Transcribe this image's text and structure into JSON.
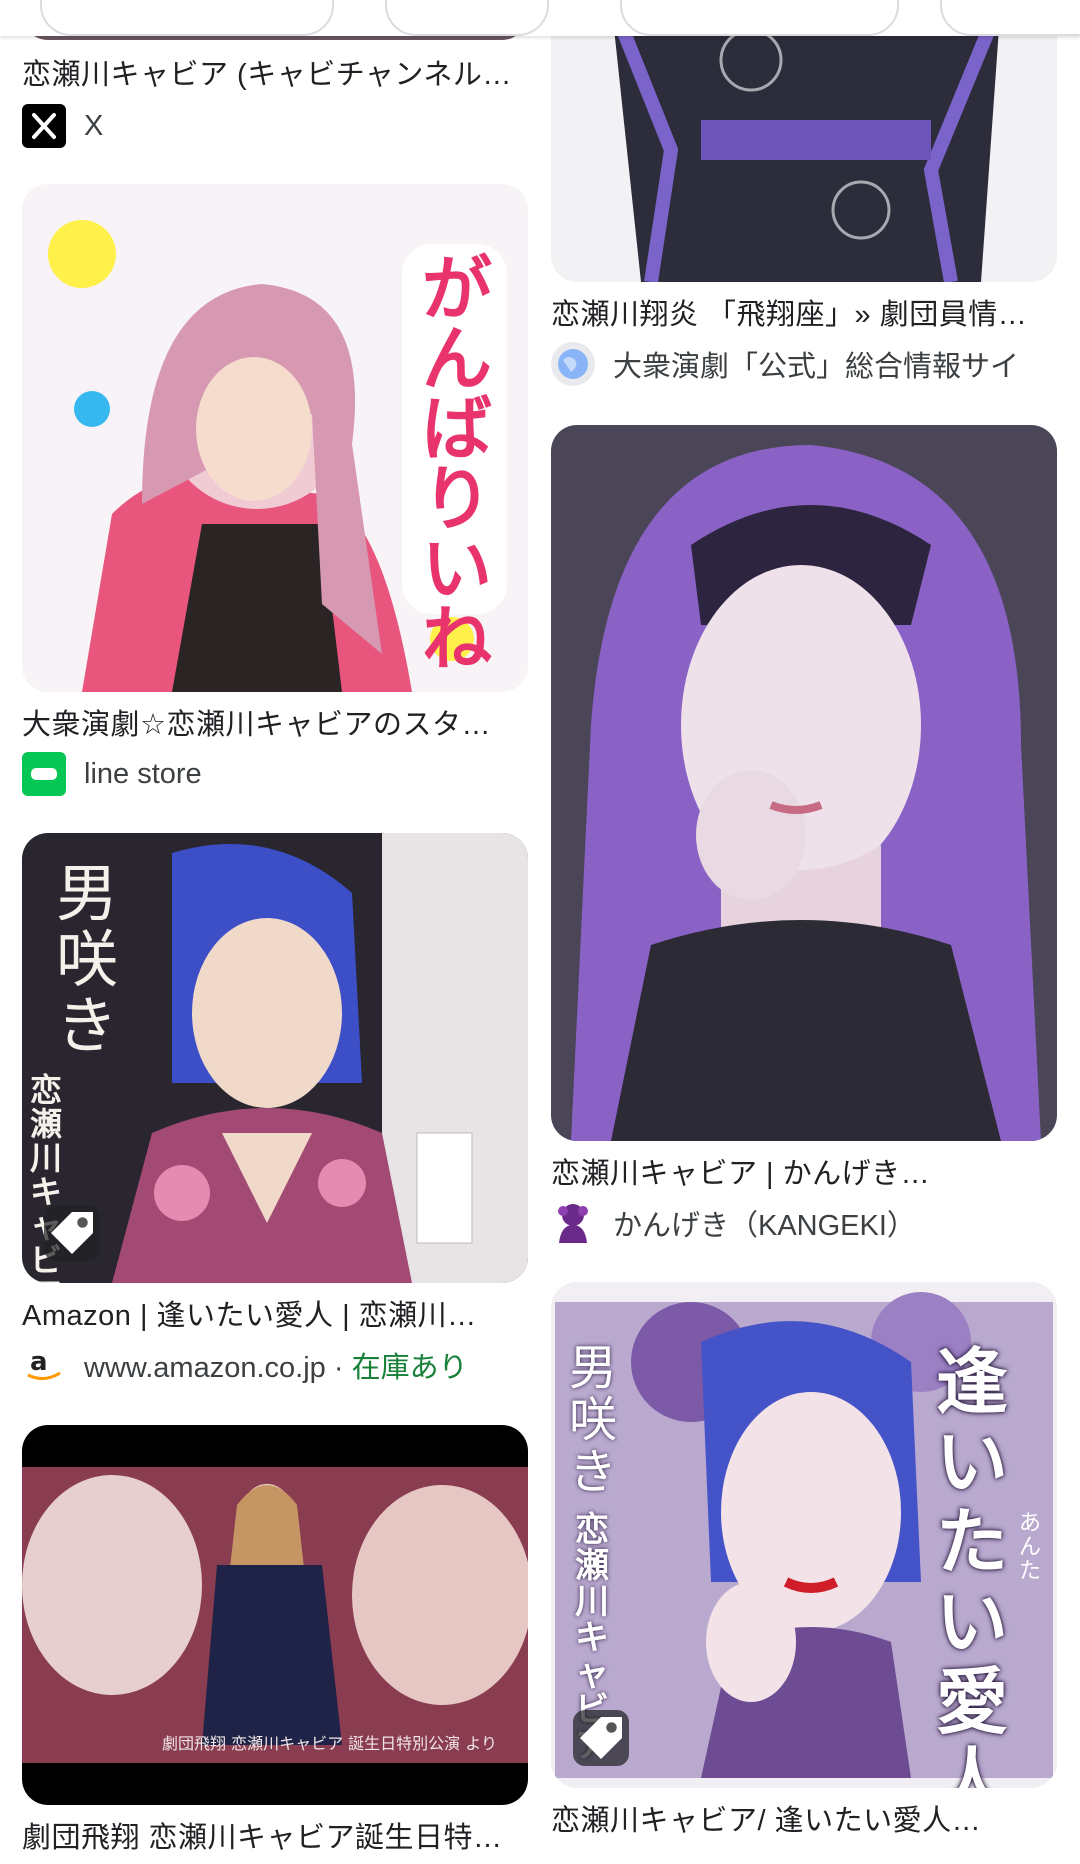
{
  "left_column": {
    "card0": {
      "title": "恋瀬川キャビア (キャビチャンネル…",
      "source": "X",
      "icon": "x-logo-icon"
    },
    "card1": {
      "title": "大衆演劇☆恋瀬川キャビアのスタ…",
      "source": "line store",
      "icon": "line-store-icon",
      "sticker_text": "がんばりいね"
    },
    "card2": {
      "title": "Amazon | 逢いたい愛人 | 恋瀬川…",
      "source": "www.amazon.co.jp",
      "source_sep": " · ",
      "stock": "在庫あり",
      "icon": "amazon-icon",
      "cover_text": "男咲き",
      "cover_artist": "恋瀬川キャビア"
    },
    "card3": {
      "title": "劇団飛翔 恋瀬川キャビア誕生日特…",
      "caption": "劇団飛翔 恋瀬川キャビア 誕生日特別公演 より"
    }
  },
  "right_column": {
    "card0": {
      "title": "恋瀬川翔炎 「飛翔座」» 劇団員情…",
      "source": "大衆演劇「公式」総合情報サイ",
      "icon": "globe-icon"
    },
    "card1": {
      "title": "恋瀬川キャビア | かんげき…",
      "source": "かんげき（KANGEKI）",
      "icon": "kangeki-icon"
    },
    "card2": {
      "title": "恋瀬川キャビア/ 逢いたい愛人…",
      "cover_title": "逢いたい愛人",
      "cover_ruby": "あんた",
      "cover_text": "男咲き",
      "cover_artist": "恋瀬川キャビア"
    }
  },
  "colors": {
    "stock_green": "#188038",
    "line_green": "#06c755",
    "amazon_orange": "#ff9900"
  }
}
